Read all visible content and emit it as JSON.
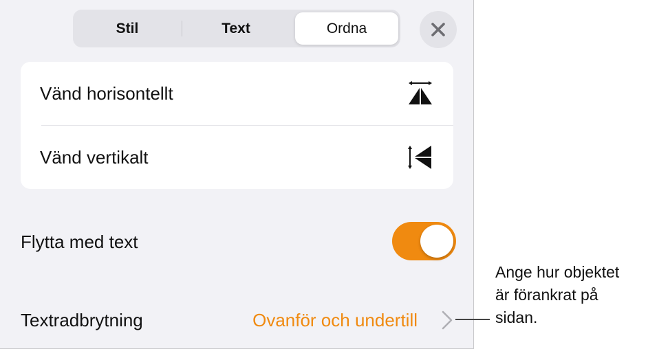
{
  "tabs": [
    {
      "label": "Stil",
      "selected": false
    },
    {
      "label": "Text",
      "selected": false
    },
    {
      "label": "Ordna",
      "selected": true
    }
  ],
  "close_icon": "xmark-icon",
  "flip": {
    "horizontal_label": "Vänd horisontellt",
    "horizontal_icon": "flip-horizontal-icon",
    "vertical_label": "Vänd vertikalt",
    "vertical_icon": "flip-vertical-icon"
  },
  "move_with_text": {
    "label": "Flytta med text",
    "on": true
  },
  "text_wrap": {
    "label": "Textradbrytning",
    "value": "Ovanför och undertill",
    "icon": "chevron-right-icon"
  },
  "callout": {
    "lines": [
      "Ange hur objektet",
      "är förankrat på",
      "sidan."
    ]
  },
  "colors": {
    "accent": "#f08a10",
    "panel": "#f2f2f6",
    "segment_bg": "#e3e3e8"
  }
}
